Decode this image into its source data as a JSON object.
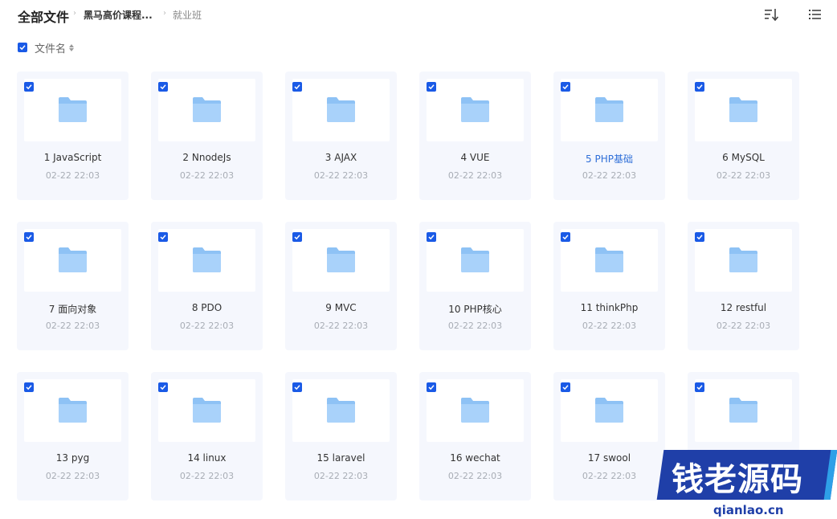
{
  "breadcrumb": {
    "root": "全部文件",
    "items": [
      "黑马高价课程...",
      "就业班"
    ]
  },
  "toolbar": {
    "sort_icon": "sort-icon",
    "view_icon": "list-view-icon"
  },
  "select_bar": {
    "checked": true,
    "sort_label": "文件名"
  },
  "colors": {
    "accent": "#1a5ae6",
    "active_name": "#2f6fd8",
    "card_bg": "#f5f7fd",
    "folder": "#8ec2f5"
  },
  "files": [
    {
      "name": "1 JavaScript",
      "date": "02-22 22:03",
      "checked": true
    },
    {
      "name": "2 NnodeJs",
      "date": "02-22 22:03",
      "checked": true
    },
    {
      "name": "3 AJAX",
      "date": "02-22 22:03",
      "checked": true
    },
    {
      "name": "4 VUE",
      "date": "02-22 22:03",
      "checked": true
    },
    {
      "name": "5 PHP基础",
      "date": "02-22 22:03",
      "checked": true,
      "active": true
    },
    {
      "name": "6 MySQL",
      "date": "02-22 22:03",
      "checked": true
    },
    {
      "name": "7 面向对象",
      "date": "02-22 22:03",
      "checked": true
    },
    {
      "name": "8 PDO",
      "date": "02-22 22:03",
      "checked": true
    },
    {
      "name": "9 MVC",
      "date": "02-22 22:03",
      "checked": true
    },
    {
      "name": "10 PHP核心",
      "date": "02-22 22:03",
      "checked": true
    },
    {
      "name": "11 thinkPhp",
      "date": "02-22 22:03",
      "checked": true
    },
    {
      "name": "12 restful",
      "date": "02-22 22:03",
      "checked": true
    },
    {
      "name": "13 pyg",
      "date": "02-22 22:03",
      "checked": true
    },
    {
      "name": "14 linux",
      "date": "02-22 22:03",
      "checked": true
    },
    {
      "name": "15 laravel",
      "date": "02-22 22:03",
      "checked": true
    },
    {
      "name": "16 wechat",
      "date": "02-22 22:03",
      "checked": true
    },
    {
      "name": "17 swool",
      "date": "02-22 22:03",
      "checked": true
    },
    {
      "name": "",
      "date": "",
      "checked": true
    }
  ],
  "watermark": {
    "text": "钱老源码",
    "url": "qianlao.cn"
  }
}
